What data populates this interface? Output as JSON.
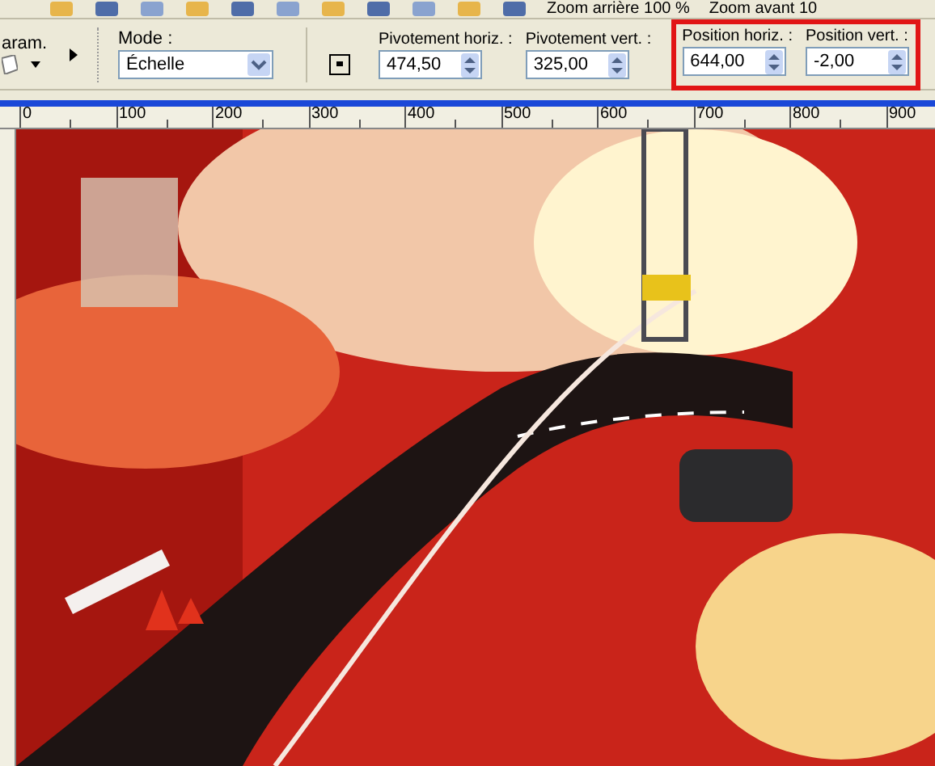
{
  "toolbar": {
    "labels": [
      "Zoom arrière 100 %",
      "Zoom avant 10"
    ]
  },
  "tool_options": {
    "presets_label": "aram.",
    "mode": {
      "label": "Mode :",
      "value": "Échelle"
    },
    "fields": [
      {
        "label": "Pivotement horiz. :",
        "value": "474,50",
        "highlighted": false
      },
      {
        "label": "Pivotement vert. :",
        "value": "325,00",
        "highlighted": false
      },
      {
        "label": "Position horiz. :",
        "value": "644,00",
        "highlighted": true
      },
      {
        "label": "Position vert. :",
        "value": "-2,00",
        "highlighted": true
      }
    ]
  },
  "ruler": {
    "ticks": [
      "0",
      "100",
      "200",
      "300",
      "400",
      "500",
      "600",
      "700",
      "800",
      "900"
    ]
  }
}
